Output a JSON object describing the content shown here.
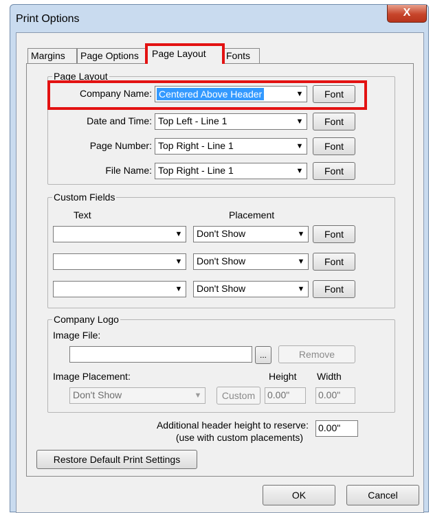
{
  "window": {
    "title": "Print Options",
    "close_label": "X"
  },
  "tabs": [
    {
      "label": "Margins"
    },
    {
      "label": "Page Options"
    },
    {
      "label": "Page Layout"
    },
    {
      "label": "Fonts"
    }
  ],
  "page_layout": {
    "legend": "Page Layout",
    "rows": [
      {
        "label": "Company Name:",
        "value": "Centered Above Header",
        "button": "Font"
      },
      {
        "label": "Date and Time:",
        "value": "Top Left - Line 1",
        "button": "Font"
      },
      {
        "label": "Page Number:",
        "value": "Top Right - Line 1",
        "button": "Font"
      },
      {
        "label": "File Name:",
        "value": "Top Right - Line 1",
        "button": "Font"
      }
    ]
  },
  "custom_fields": {
    "legend": "Custom Fields",
    "text_header": "Text",
    "placement_header": "Placement",
    "rows": [
      {
        "text": "",
        "placement": "Don't Show",
        "button": "Font"
      },
      {
        "text": "",
        "placement": "Don't Show",
        "button": "Font"
      },
      {
        "text": "",
        "placement": "Don't Show",
        "button": "Font"
      }
    ]
  },
  "company_logo": {
    "legend": "Company Logo",
    "image_file_label": "Image File:",
    "image_file_value": "",
    "browse_label": "...",
    "remove_label": "Remove",
    "placement_label": "Image Placement:",
    "height_label": "Height",
    "width_label": "Width",
    "placement_value": "Don't Show",
    "custom_label": "Custom",
    "height_value": "0.00\"",
    "width_value": "0.00\""
  },
  "additional": {
    "line1": "Additional header height to reserve:",
    "line2": "(use with custom placements)",
    "value": "0.00\""
  },
  "footer": {
    "restore_label": "Restore Default Print Settings",
    "ok_label": "OK",
    "cancel_label": "Cancel"
  },
  "colors": {
    "highlight": "#e31212",
    "selection": "#3399ff",
    "title_bar": "#c9dbef",
    "close_button": "#c7452b"
  }
}
